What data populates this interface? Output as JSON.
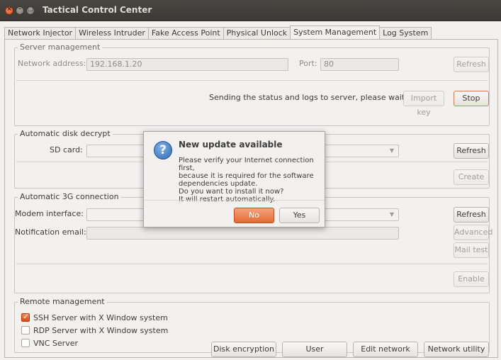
{
  "window": {
    "title": "Tactical Control Center"
  },
  "tabs": [
    {
      "label": "Network Injector"
    },
    {
      "label": "Wireless Intruder"
    },
    {
      "label": "Fake Access Point"
    },
    {
      "label": "Physical Unlock"
    },
    {
      "label": "System Management"
    },
    {
      "label": "Log System"
    }
  ],
  "server": {
    "title": "Server management",
    "address_label": "Network address:",
    "address_value": "192.168.1.20",
    "port_label": "Port:",
    "port_value": "80",
    "refresh_label": "Refresh",
    "status_text": "Sending the status and logs to server, please wait...",
    "import_key_label": "Import key",
    "stop_label": "Stop"
  },
  "disk": {
    "title": "Automatic disk decrypt",
    "sd_label": "SD card:",
    "refresh_label": "Refresh",
    "create_label": "Create"
  },
  "modem": {
    "title": "Automatic 3G connection",
    "interface_label": "Modem interface:",
    "email_label": "Notification email:",
    "refresh_label": "Refresh",
    "advanced_label": "Advanced",
    "mailtest_label": "Mail test",
    "enable_label": "Enable"
  },
  "remote": {
    "title": "Remote management",
    "options": [
      {
        "label": "SSH Server with X Window system",
        "checked": true
      },
      {
        "label": "RDP Server with X Window system",
        "checked": false
      },
      {
        "label": "VNC Server",
        "checked": false
      }
    ]
  },
  "bottom": {
    "disk_encryption": "Disk encryption",
    "user_management": "User management",
    "edit_network": "Edit network",
    "network_utility": "Network utility"
  },
  "dialog": {
    "title": "New update available",
    "body": "Please verify your Internet connection first,\nbecause it is required for the software\ndependencies update.\nDo you want to install it now?\nIt will restart automatically.",
    "no_label": "No",
    "yes_label": "Yes"
  },
  "colors": {
    "accent": "#dd4814",
    "info_icon": "#2e6bb8"
  },
  "icons": {
    "dialog": "question-icon"
  }
}
